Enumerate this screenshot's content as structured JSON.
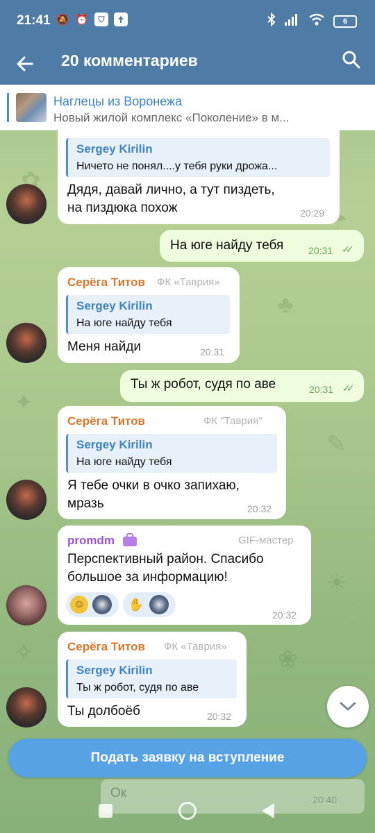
{
  "status_bar": {
    "time": "21:41",
    "battery": "6",
    "icons": [
      "mute-icon",
      "alarm-icon",
      "shield-icon",
      "upload-icon",
      "bluetooth-icon",
      "signal-icon",
      "wifi-icon",
      "battery-icon"
    ]
  },
  "header": {
    "title": "20 комментариев"
  },
  "pinned": {
    "title": "Наглецы из Воронежа",
    "text": "Новый жилой комплекс «Поколение» в м..."
  },
  "messages": [
    {
      "reply_name": "Sergey Kirilin",
      "reply_text": "Ничето не понял....у тебя руки дрожа...",
      "text_line1": "Дядя, давай лично, а тут пиздеть,",
      "text_line2": "на пиздюка похож",
      "time": "20:29"
    },
    {
      "text": "На юге найду тебя",
      "time": "20:31"
    },
    {
      "sender": "Серёга Титов",
      "badge": "ФК «Таврия»",
      "reply_name": "Sergey Kirilin",
      "reply_text": "На юге найду тебя",
      "text": "Меня найди",
      "time": "20:31"
    },
    {
      "text": "Ты ж робот, судя по аве",
      "time": "20:31"
    },
    {
      "sender": "Серёга Титов",
      "badge": "ФК \"Таврия\"",
      "reply_name": "Sergey Kirilin",
      "reply_text": "На юге найду тебя",
      "text_line1": "Я тебе очки  в очко запихаю,",
      "text_line2": "мразь",
      "time": "20:32"
    },
    {
      "sender": "promdm",
      "badge": "GIF-мастер",
      "text_line1": "Перспективный район. Спасибо",
      "text_line2": "большое за информацию!",
      "time": "20:32"
    },
    {
      "sender": "Серёга Титов",
      "badge": "ФК «Таврия»",
      "reply_name": "Sergey Kirilin",
      "reply_text": "Ты ж робот, судя по аве",
      "text": "Ты долбоёб",
      "time": "20:32"
    }
  ],
  "ghost_message": {
    "text": "Ок",
    "time": "20:40"
  },
  "join_button": "Подать заявку на вступление",
  "colors": {
    "header": "#4f7ca6",
    "accent": "#3d84c5",
    "sender_orange": "#d9772d",
    "sender_purple": "#9a55d6",
    "outgoing_bubble": "#effdde",
    "join_button": "#56a2e4"
  }
}
